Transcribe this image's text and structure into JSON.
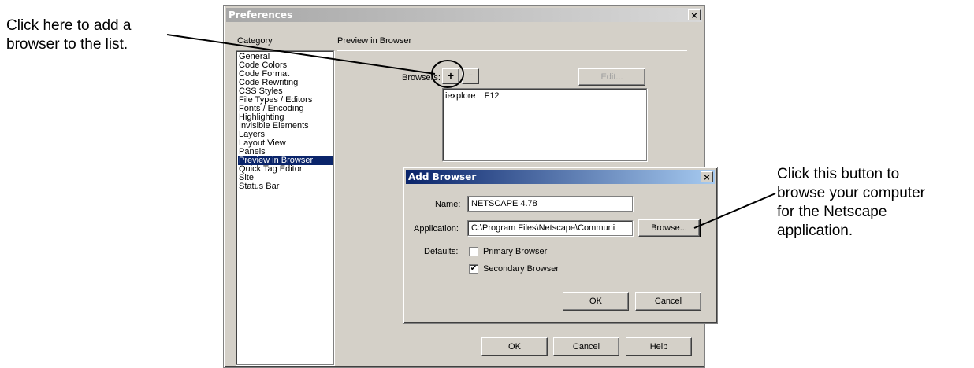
{
  "callouts": {
    "left": [
      "Click here to add a",
      "browser to the list."
    ],
    "right": [
      "Click this button to",
      "browse your computer",
      "for the Netscape",
      "application."
    ]
  },
  "preferences": {
    "title": "Preferences",
    "close": "×",
    "category_label": "Category",
    "section_title": "Preview in Browser",
    "categories": [
      "General",
      "Code Colors",
      "Code Format",
      "Code Rewriting",
      "CSS Styles",
      "File Types / Editors",
      "Fonts / Encoding",
      "Highlighting",
      "Invisible Elements",
      "Layers",
      "Layout View",
      "Panels",
      "Preview in Browser",
      "Quick Tag Editor",
      "Site",
      "Status Bar"
    ],
    "selected_category": "Preview in Browser",
    "browsers_label": "Browsers:",
    "add_button": "+",
    "remove_button": "−",
    "edit_button": "Edit...",
    "browser_list": [
      {
        "name": "iexplore",
        "key": "F12"
      }
    ],
    "ok_button": "OK",
    "cancel_button": "Cancel",
    "help_button": "Help"
  },
  "add_browser": {
    "title": "Add Browser",
    "close": "×",
    "name_label": "Name:",
    "name_value": "NETSCAPE 4.78",
    "application_label": "Application:",
    "application_value": "C:\\Program Files\\Netscape\\Communi",
    "browse_button": "Browse...",
    "defaults_label": "Defaults:",
    "primary_label": "Primary Browser",
    "primary_checked": false,
    "secondary_label": "Secondary Browser",
    "secondary_checked": true,
    "check_mark": "✔",
    "ok_button": "OK",
    "cancel_button": "Cancel"
  }
}
